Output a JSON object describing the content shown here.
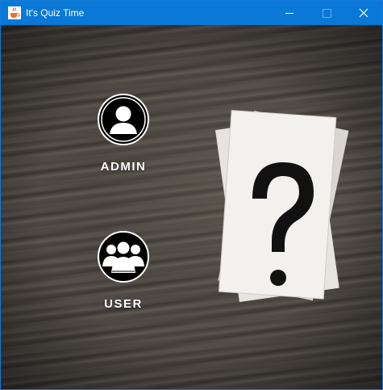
{
  "window": {
    "title": "It's Quiz Time",
    "icon": "java-cup-icon",
    "controls": [
      "minimize",
      "maximize",
      "close"
    ]
  },
  "roles": {
    "admin": {
      "label": "ADMIN",
      "icon": "person-icon"
    },
    "user": {
      "label": "USER",
      "icon": "group-icon"
    }
  },
  "background": {
    "description_icon": "question-mark-cards-image"
  },
  "colors": {
    "titlebar": "#0a78d7",
    "label": "#ffffff",
    "icon_bg": "#000000"
  }
}
